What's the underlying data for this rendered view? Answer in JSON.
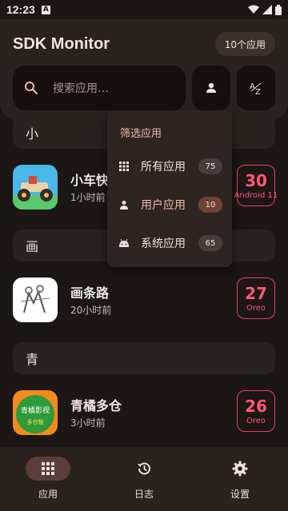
{
  "status_bar": {
    "time": "12:23",
    "notif_icon": "A"
  },
  "header": {
    "title": "SDK Monitor",
    "count_chip": "10个应用"
  },
  "search": {
    "placeholder": "搜索应用…"
  },
  "sections": [
    {
      "label": "小"
    },
    {
      "label": "画"
    },
    {
      "label": "青"
    }
  ],
  "apps": [
    {
      "name": "小车快",
      "time": "1小时前",
      "sdk": "30",
      "version": "Android 11"
    },
    {
      "name": "画条路",
      "time": "20小时前",
      "sdk": "27",
      "version": "Oreo"
    },
    {
      "name": "青橘多仓",
      "time": "3小时前",
      "sdk": "26",
      "version": "Oreo",
      "icon_text_top": "青橘影视",
      "icon_text_bottom": "多仓版"
    }
  ],
  "filter_menu": {
    "title": "筛选应用",
    "items": [
      {
        "label": "所有应用",
        "count": "75",
        "icon": "grid-icon"
      },
      {
        "label": "用户应用",
        "count": "10",
        "icon": "person-icon",
        "selected": true
      },
      {
        "label": "系统应用",
        "count": "65",
        "icon": "android-icon"
      }
    ]
  },
  "bottom_nav": [
    {
      "label": "应用",
      "icon": "apps-grid-icon",
      "active": true
    },
    {
      "label": "日志",
      "icon": "history-icon"
    },
    {
      "label": "设置",
      "icon": "gear-icon"
    }
  ],
  "colors": {
    "badge": "#e5425a",
    "accent": "#f0b9a8",
    "background": "#1c1614"
  }
}
